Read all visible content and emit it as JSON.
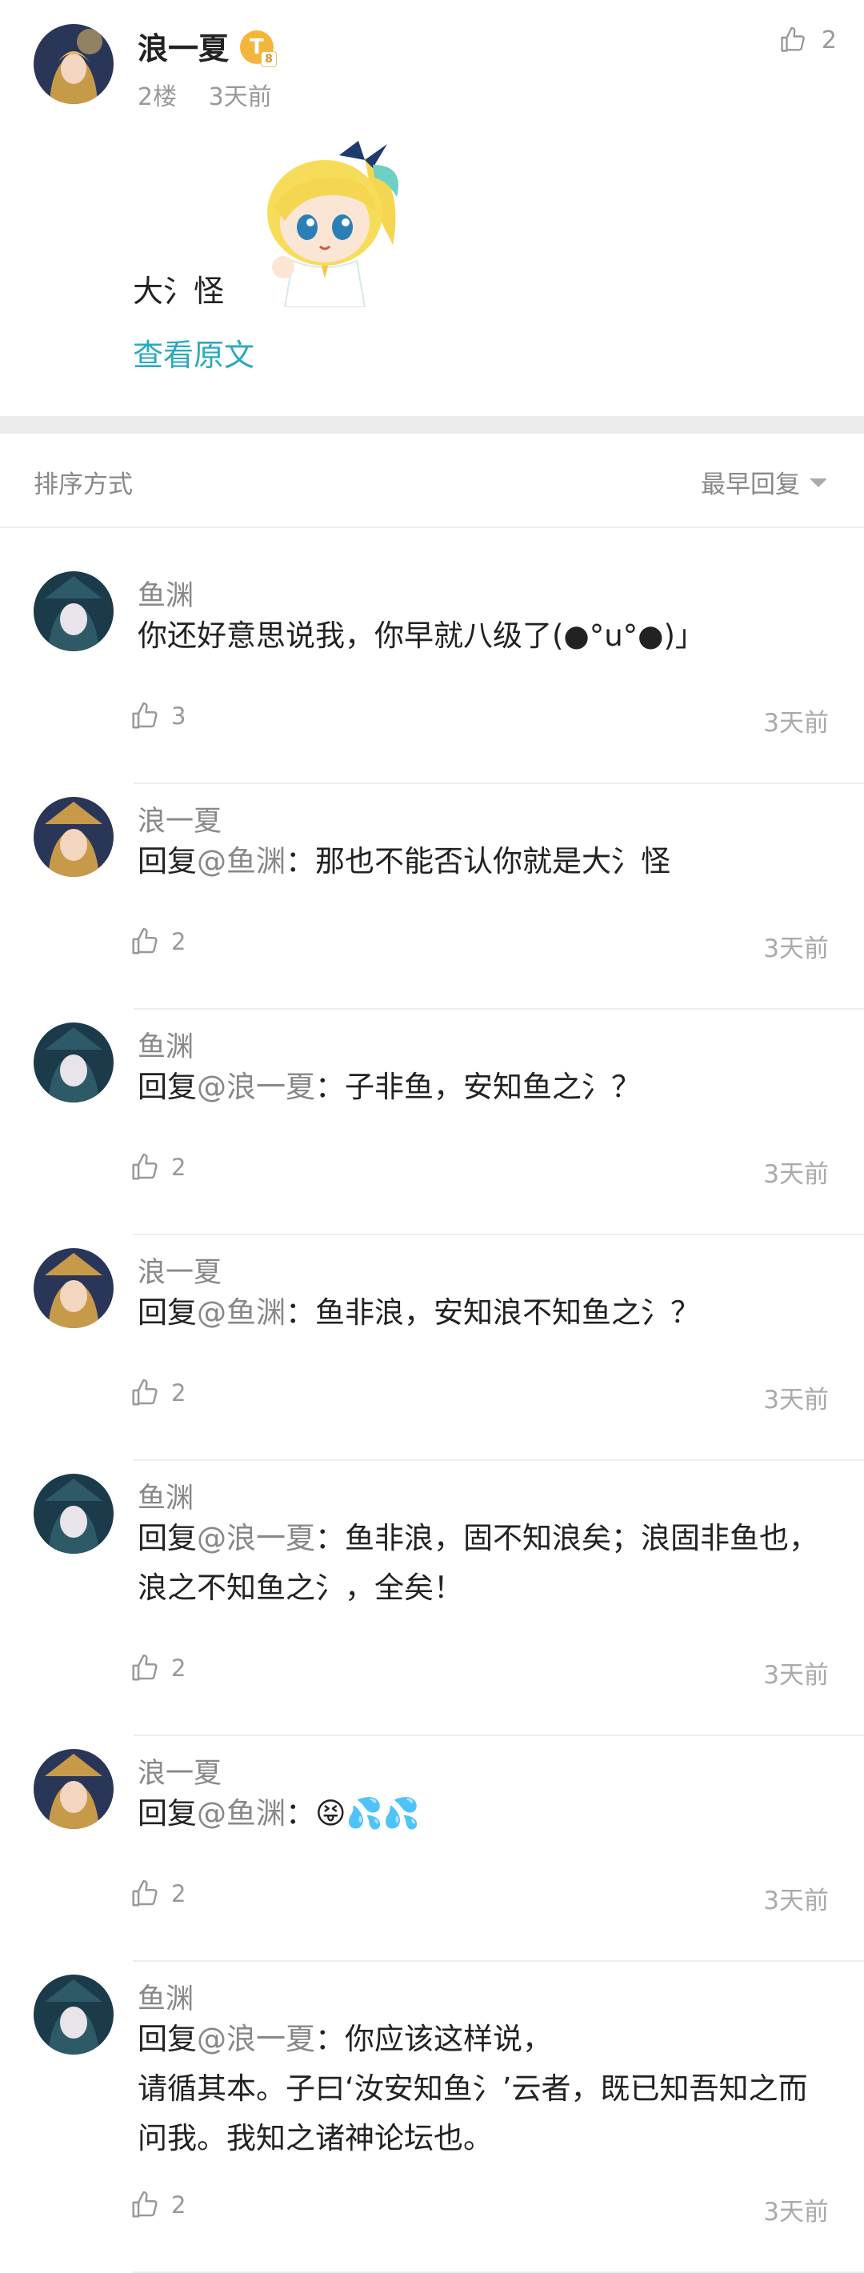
{
  "post": {
    "author": "浪一夏",
    "badge": "T",
    "badge_sub": "8",
    "floor": "2楼",
    "time": "3天前",
    "likes": "2",
    "content": "大氵怪",
    "view_original": "查看原文"
  },
  "sort": {
    "label": "排序方式",
    "value": "最早回复"
  },
  "replies": [
    {
      "author": "鱼渊",
      "prefix": "",
      "mention": "",
      "text": "你还好意思说我，你早就八级了(●°u°●)」",
      "likes": "3",
      "time": "3天前"
    },
    {
      "author": "浪一夏",
      "prefix": "回复",
      "mention": "@鱼渊",
      "text": "：那也不能否认你就是大氵怪",
      "likes": "2",
      "time": "3天前"
    },
    {
      "author": "鱼渊",
      "prefix": "回复",
      "mention": "@浪一夏",
      "text": "：子非鱼，安知鱼之氵？",
      "likes": "2",
      "time": "3天前"
    },
    {
      "author": "浪一夏",
      "prefix": "回复",
      "mention": "@鱼渊",
      "text": "：鱼非浪，安知浪不知鱼之氵？",
      "likes": "2",
      "time": "3天前"
    },
    {
      "author": "鱼渊",
      "prefix": "回复",
      "mention": "@浪一夏",
      "text": "：鱼非浪，固不知浪矣；浪固非鱼也，浪之不知鱼之氵，全矣！",
      "likes": "2",
      "time": "3天前"
    },
    {
      "author": "浪一夏",
      "prefix": "回复",
      "mention": "@鱼渊",
      "text": "：😝💦💦",
      "likes": "2",
      "time": "3天前"
    },
    {
      "author": "鱼渊",
      "prefix": "回复",
      "mention": "@浪一夏",
      "text": "：你应该这样说，\n请循其本。子曰‘汝安知鱼氵’云者，既已知吾知之而问我。我知之诸神论坛也。",
      "likes": "2",
      "time": "3天前"
    }
  ]
}
